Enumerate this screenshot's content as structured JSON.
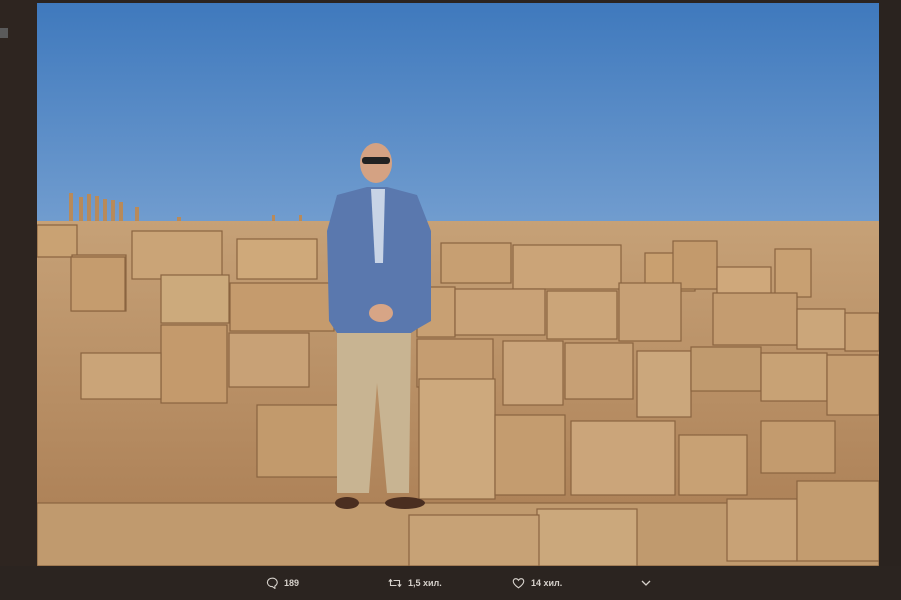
{
  "photo": {
    "subject": "photo-person-at-ruins"
  },
  "actions": {
    "reply": {
      "icon": "reply-icon",
      "count": "189"
    },
    "retweet": {
      "icon": "retweet-icon",
      "count": "1,5 хил."
    },
    "like": {
      "icon": "heart-icon",
      "count": "14 хил."
    },
    "more": {
      "icon": "chevron-down-icon"
    }
  },
  "colors": {
    "sky": "#4f86c6",
    "stone": "#c49a68",
    "background": "#2b2420",
    "action_text": "#d7d2cc"
  }
}
